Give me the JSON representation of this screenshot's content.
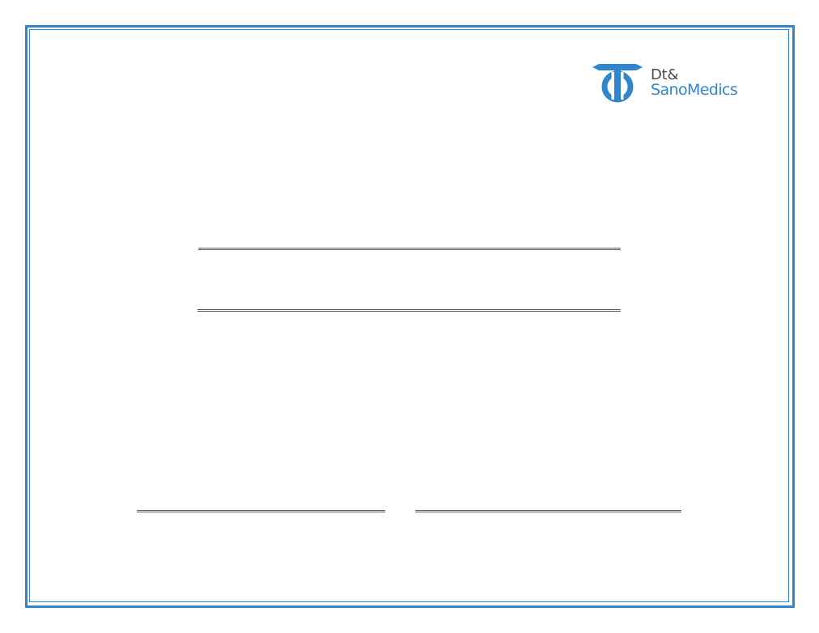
{
  "logo": {
    "line1": "Dt&",
    "line2": "SanoMedics",
    "mark_icon": "dt-sanomedics-logo-mark-icon",
    "colors": {
      "brand_blue": "#2f86cf",
      "text_gray": "#4a4a4a"
    }
  },
  "form": {
    "title_value": "",
    "subtitle_value": "",
    "signature_left_value": "",
    "signature_right_value": ""
  },
  "colors": {
    "frame": "#2f86cf",
    "rule": "#555555",
    "background": "#ffffff"
  }
}
